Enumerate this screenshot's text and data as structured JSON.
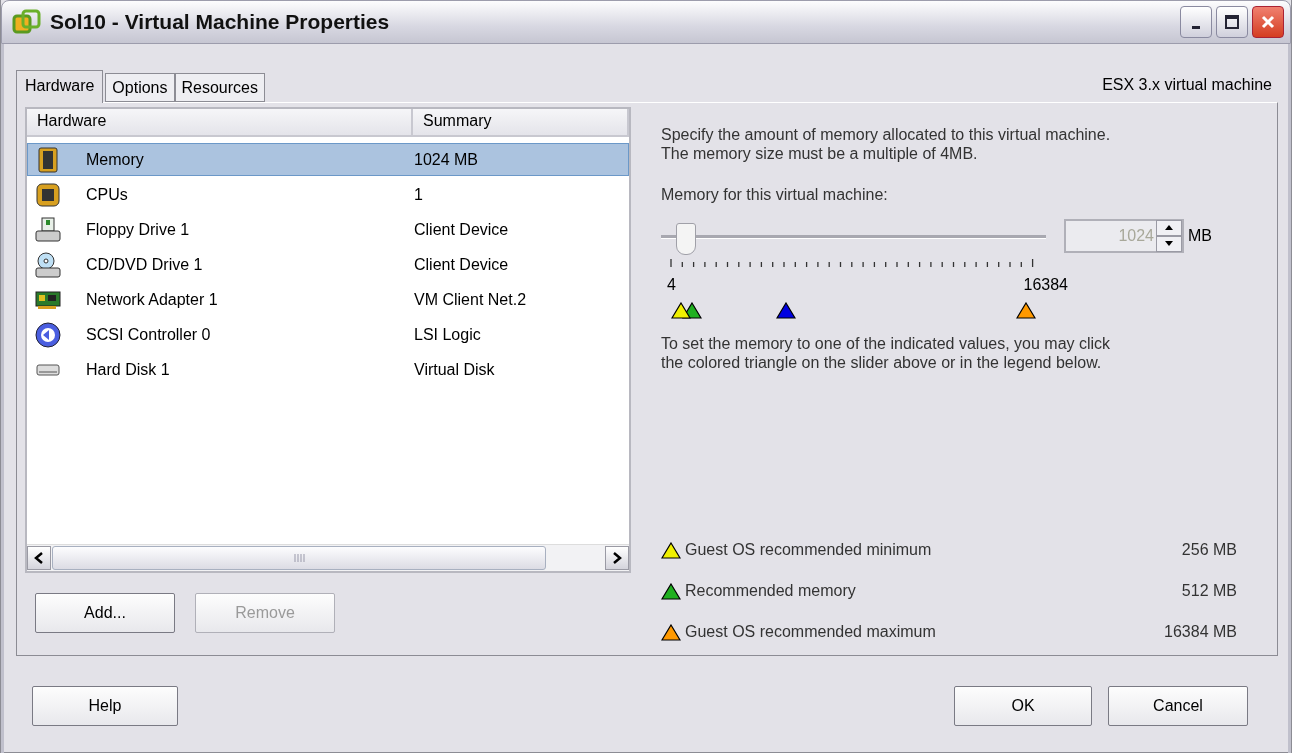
{
  "window": {
    "title": "Sol10 - Virtual Machine Properties"
  },
  "tabs": [
    {
      "label": "Hardware",
      "selected": true
    },
    {
      "label": "Options",
      "selected": false
    },
    {
      "label": "Resources",
      "selected": false
    }
  ],
  "vm_version": "ESX 3.x virtual machine",
  "hardware_table": {
    "columns": [
      "Hardware",
      "Summary"
    ],
    "rows": [
      {
        "kind": "memory",
        "name": "Memory",
        "summary": "1024 MB",
        "selected": true
      },
      {
        "kind": "cpu",
        "name": "CPUs",
        "summary": "1",
        "selected": false
      },
      {
        "kind": "floppy",
        "name": "Floppy Drive 1",
        "summary": "Client Device",
        "selected": false
      },
      {
        "kind": "cdrom",
        "name": "CD/DVD Drive 1",
        "summary": "Client Device",
        "selected": false
      },
      {
        "kind": "network",
        "name": "Network Adapter 1",
        "summary": "VM Client Net.2",
        "selected": false
      },
      {
        "kind": "scsi",
        "name": "SCSI Controller 0",
        "summary": "LSI Logic",
        "selected": false
      },
      {
        "kind": "disk",
        "name": "Hard Disk 1",
        "summary": "Virtual Disk",
        "selected": false
      }
    ]
  },
  "list_buttons": [
    {
      "label": "Add...",
      "disabled": false
    },
    {
      "label": "Remove",
      "disabled": true
    }
  ],
  "memory": {
    "description": "Specify the amount of memory allocated to this virtual machine. The memory size must be a multiple of 4MB.",
    "slider_label": "Memory for this virtual machine:",
    "slider": {
      "level": 0.062
    },
    "value": "1024",
    "value_disabled": true,
    "unit": "MB",
    "min_label": "4",
    "max_label": "16384",
    "markers": [
      {
        "color": "#f0f000"
      },
      {
        "color": "#20b020"
      },
      {
        "color": "#0000e0"
      },
      {
        "color": "#ff9900"
      }
    ],
    "hint": "To set the memory to one of the indicated values, you may click the colored triangle on the slider above or in the legend below.",
    "legend": [
      {
        "color": "#f0f000",
        "label": "Guest OS recommended minimum",
        "value": "256 MB"
      },
      {
        "color": "#20b020",
        "label": "Recommended memory",
        "value": "512 MB"
      },
      {
        "color": "#ff9900",
        "label": "Guest OS recommended maximum",
        "value": "16384 MB"
      }
    ]
  },
  "footer_buttons": {
    "help": "Help",
    "ok": "OK",
    "cancel": "Cancel"
  }
}
